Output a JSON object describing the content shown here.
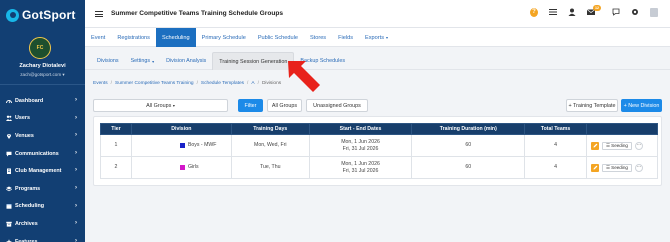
{
  "brand": {
    "name": "GotSport"
  },
  "user": {
    "avatar_text": "FC",
    "name": "Zachary Diotalevi",
    "email": "zach@gotsport.com"
  },
  "sidebar": {
    "items": [
      {
        "label": "Dashboard",
        "icon": "gauge-icon"
      },
      {
        "label": "Users",
        "icon": "users-icon"
      },
      {
        "label": "Venues",
        "icon": "map-pin-icon"
      },
      {
        "label": "Communications",
        "icon": "chat-icon"
      },
      {
        "label": "Club Management",
        "icon": "building-icon"
      },
      {
        "label": "Programs",
        "icon": "layers-icon"
      },
      {
        "label": "Scheduling",
        "icon": "calendar-icon"
      },
      {
        "label": "Archives",
        "icon": "archive-icon"
      },
      {
        "label": "Features",
        "icon": "star-icon"
      }
    ]
  },
  "topbar": {
    "title": "Summer Competitive Teams Training Schedule Groups",
    "notification_count": "12",
    "help_label": "?"
  },
  "main_tabs": [
    {
      "label": "Event",
      "active": false
    },
    {
      "label": "Registrations",
      "active": false
    },
    {
      "label": "Scheduling",
      "active": true
    },
    {
      "label": "Primary Schedule",
      "active": false
    },
    {
      "label": "Public Schedule",
      "active": false
    },
    {
      "label": "Stores",
      "active": false
    },
    {
      "label": "Fields",
      "active": false
    },
    {
      "label": "Exports",
      "active": false,
      "dropdown": true
    }
  ],
  "sub_tabs": [
    {
      "label": "Divisions",
      "active": false
    },
    {
      "label": "Settings",
      "active": false,
      "dropdown": true
    },
    {
      "label": "Division Analysis",
      "active": false
    },
    {
      "label": "Training Session Generation",
      "active": true
    },
    {
      "label": "Backup Schedules",
      "active": false
    }
  ],
  "breadcrumb": [
    "Events",
    "Summer Competitive Teams Training",
    "Schedule Templates",
    "A",
    "Divisions"
  ],
  "breadcrumb_sep": "/",
  "filters": {
    "groups_select": "All Groups",
    "filter_label": "Filter",
    "all_groups_label": "All Groups",
    "unassigned_label": "Unassigned Groups",
    "training_template_label": "+ Training Template",
    "new_division_label": "+ New Division"
  },
  "table": {
    "headers": [
      "Tier",
      "Division",
      "Training Days",
      "Start - End Dates",
      "Training Duration (min)",
      "Total Teams",
      ""
    ],
    "rows": [
      {
        "tier": "1",
        "division": "Boys - MWF",
        "swatch": "#1a22c8",
        "days": "Mon, Wed, Fri",
        "start": "Mon, 1 Jun 2026",
        "end": "Fri, 31 Jul 2026",
        "duration": "60",
        "teams": "4",
        "seeding": "Seeding",
        "more": "···"
      },
      {
        "tier": "2",
        "division": "Girls",
        "swatch": "#d317c9",
        "days": "Tue, Thu",
        "start": "Mon, 1 Jun 2026",
        "end": "Fri, 31 Jul 2026",
        "duration": "60",
        "teams": "4",
        "seeding": "Seeding",
        "more": "···"
      }
    ]
  },
  "colors": {
    "sidebar": "#123f73",
    "accent": "#1c8ae8",
    "active_tab": "#1c6fc0",
    "table_header": "#173e6b",
    "warning": "#f4a523",
    "annotation": "#e8221b"
  }
}
